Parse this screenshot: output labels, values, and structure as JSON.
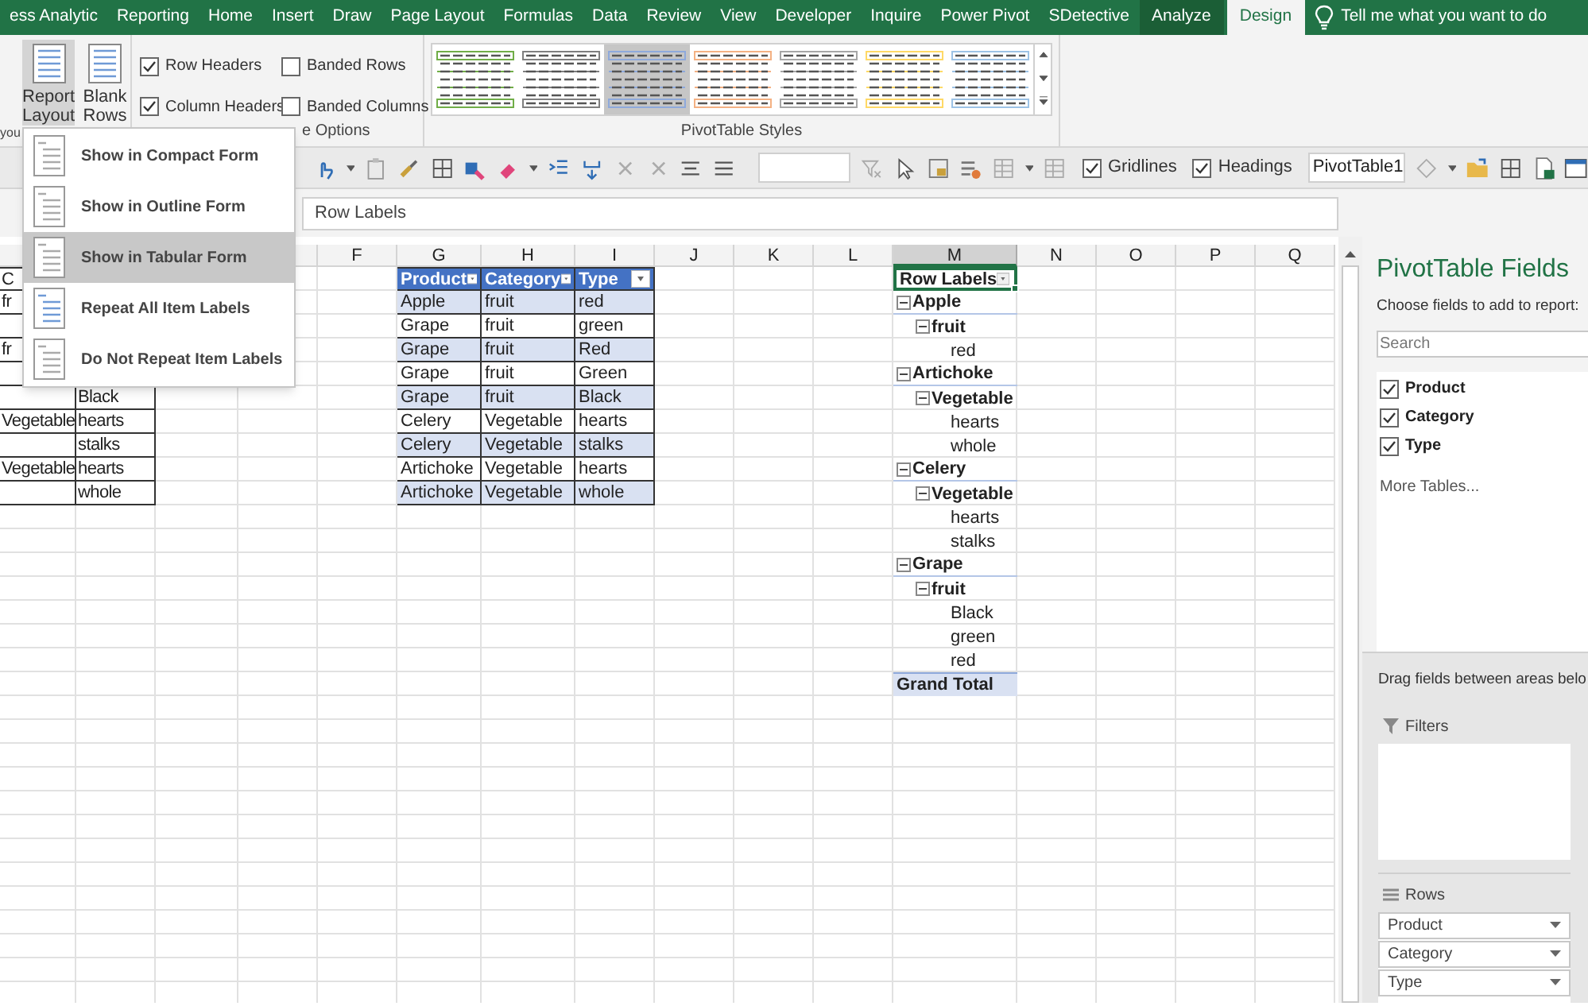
{
  "ribbon_tabs": [
    {
      "label": "ess Analytic",
      "selected": false,
      "contextual": false
    },
    {
      "label": "Reporting",
      "selected": false,
      "contextual": false
    },
    {
      "label": "Home",
      "selected": false,
      "contextual": false
    },
    {
      "label": "Insert",
      "selected": false,
      "contextual": false
    },
    {
      "label": "Draw",
      "selected": false,
      "contextual": false
    },
    {
      "label": "Page Layout",
      "selected": false,
      "contextual": false
    },
    {
      "label": "Formulas",
      "selected": false,
      "contextual": false
    },
    {
      "label": "Data",
      "selected": false,
      "contextual": false
    },
    {
      "label": "Review",
      "selected": false,
      "contextual": false
    },
    {
      "label": "View",
      "selected": false,
      "contextual": false
    },
    {
      "label": "Developer",
      "selected": false,
      "contextual": false
    },
    {
      "label": "Inquire",
      "selected": false,
      "contextual": false
    },
    {
      "label": "Power Pivot",
      "selected": false,
      "contextual": false
    },
    {
      "label": "SDetective",
      "selected": false,
      "contextual": false
    },
    {
      "label": "Analyze",
      "selected": false,
      "contextual": true
    },
    {
      "label": "Design",
      "selected": true,
      "contextual": true
    }
  ],
  "tell_me": {
    "placeholder": "Tell me what you want to do"
  },
  "ribbon": {
    "layout_group_label": "you",
    "layout_buttons": [
      {
        "label": "Report Layout",
        "pressed": true
      },
      {
        "label": "Blank Rows",
        "pressed": false
      }
    ],
    "style_options": [
      {
        "label": "Row Headers",
        "checked": true
      },
      {
        "label": "Column Headers",
        "checked": true
      },
      {
        "label": "Banded Rows",
        "checked": false
      },
      {
        "label": "Banded Columns",
        "checked": false
      }
    ],
    "style_options_label": "e Options",
    "styles": [
      {
        "color": "#70ad47",
        "selected": false
      },
      {
        "color": "#7f7f7f",
        "selected": false
      },
      {
        "color": "#8ea9db",
        "selected": true
      },
      {
        "color": "#f4b183",
        "selected": false
      },
      {
        "color": "#a6a6a6",
        "selected": false
      },
      {
        "color": "#ffd966",
        "selected": false
      },
      {
        "color": "#9dc3e6",
        "selected": false
      }
    ],
    "styles_label": "PivotTable Styles"
  },
  "toolbar": {
    "checkboxes": [
      {
        "label": "Gridlines",
        "checked": true
      },
      {
        "label": "Headings",
        "checked": true
      }
    ],
    "name_field": "PivotTable1"
  },
  "formula_bar": {
    "value": "Row Labels"
  },
  "layout_menu": [
    {
      "label": "Show in Compact Form",
      "selected": false
    },
    {
      "label": "Show in Outline Form",
      "selected": false
    },
    {
      "label": "Show in Tabular Form",
      "selected": true
    },
    {
      "label": "Repeat All Item Labels",
      "selected": false
    },
    {
      "label": "Do Not Repeat Item Labels",
      "selected": false
    }
  ],
  "columns": [
    {
      "label": "F",
      "selected": false
    },
    {
      "label": "G",
      "selected": false
    },
    {
      "label": "H",
      "selected": false
    },
    {
      "label": "I",
      "selected": false
    },
    {
      "label": "J",
      "selected": false
    },
    {
      "label": "K",
      "selected": false
    },
    {
      "label": "L",
      "selected": false
    },
    {
      "label": "M",
      "selected": true
    },
    {
      "label": "N",
      "selected": false
    },
    {
      "label": "O",
      "selected": false
    },
    {
      "label": "P",
      "selected": false
    },
    {
      "label": "Q",
      "selected": false
    }
  ],
  "left_table": {
    "rows": [
      [
        "C",
        null
      ],
      [
        "fr",
        null
      ],
      [
        null,
        null
      ],
      [
        "fr",
        null
      ],
      [
        null,
        null
      ],
      [
        null,
        "Black"
      ],
      [
        "Vegetable",
        "hearts"
      ],
      [
        null,
        "stalks"
      ],
      [
        "Vegetable",
        "hearts"
      ],
      [
        null,
        "whole"
      ]
    ]
  },
  "source_table": {
    "columns": [
      "Product",
      "Category",
      "Type"
    ],
    "rows": [
      [
        "Apple",
        "fruit",
        "red"
      ],
      [
        "Grape",
        "fruit",
        "green"
      ],
      [
        "Grape",
        "fruit",
        "Red"
      ],
      [
        "Grape",
        "fruit",
        "Green"
      ],
      [
        "Grape",
        "fruit",
        "Black"
      ],
      [
        "Celery",
        "Vegetable",
        "hearts"
      ],
      [
        "Celery",
        "Vegetable",
        "stalks"
      ],
      [
        "Artichoke",
        "Vegetable",
        "hearts"
      ],
      [
        "Artichoke",
        "Vegetable",
        "whole"
      ]
    ]
  },
  "pivot": {
    "header": "Row Labels",
    "items": [
      {
        "label": "Apple",
        "expanded": true,
        "children": [
          {
            "label": "fruit",
            "expanded": true,
            "children": [
              {
                "label": "red"
              }
            ]
          }
        ]
      },
      {
        "label": "Artichoke",
        "expanded": true,
        "children": [
          {
            "label": "Vegetable",
            "expanded": true,
            "children": [
              {
                "label": "hearts"
              },
              {
                "label": "whole"
              }
            ]
          }
        ]
      },
      {
        "label": "Celery",
        "expanded": true,
        "children": [
          {
            "label": "Vegetable",
            "expanded": true,
            "children": [
              {
                "label": "hearts"
              },
              {
                "label": "stalks"
              }
            ]
          }
        ]
      },
      {
        "label": "Grape",
        "expanded": true,
        "children": [
          {
            "label": "fruit",
            "expanded": true,
            "children": [
              {
                "label": "Black"
              },
              {
                "label": "green"
              },
              {
                "label": "red"
              }
            ]
          }
        ]
      }
    ],
    "grand_total": "Grand Total"
  },
  "fields_panel": {
    "title": "PivotTable Fields",
    "subtitle": "Choose fields to add to report:",
    "search": {
      "placeholder": "Search"
    },
    "fields": [
      {
        "label": "Product",
        "checked": true
      },
      {
        "label": "Category",
        "checked": true
      },
      {
        "label": "Type",
        "checked": true
      }
    ],
    "more_tables": "More Tables...",
    "drag_hint": "Drag fields between areas belo",
    "filters_label": "Filters",
    "rows_label": "Rows",
    "row_fields": [
      "Product",
      "Category",
      "Type"
    ]
  }
}
